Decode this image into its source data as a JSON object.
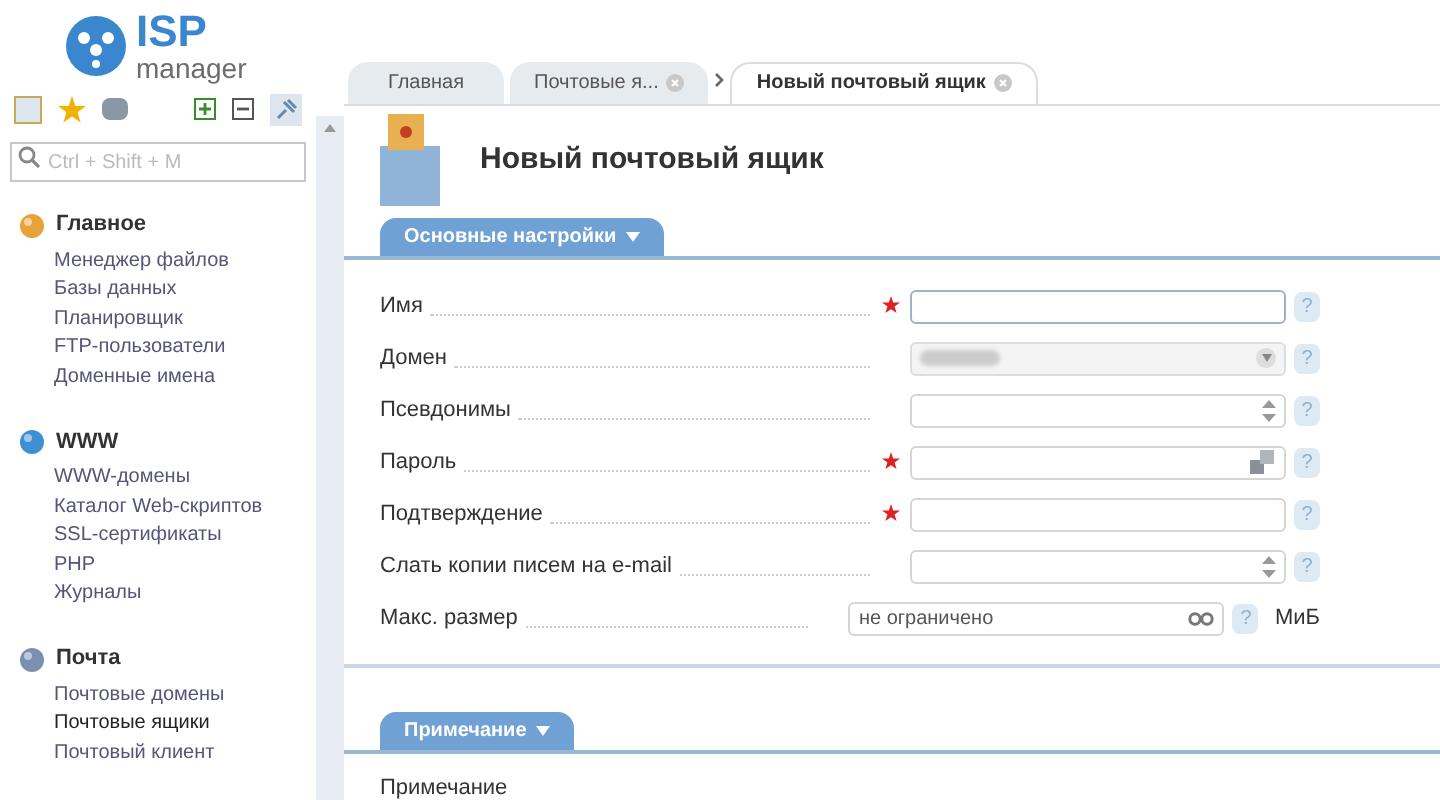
{
  "logo": {
    "brand": "ISP",
    "product": "manager"
  },
  "search": {
    "placeholder": "Ctrl + Shift + M"
  },
  "menu": [
    {
      "title": "Главное",
      "items": [
        {
          "label": "Менеджер файлов",
          "selected": false
        },
        {
          "label": "Базы данных",
          "selected": false
        },
        {
          "label": "Планировщик",
          "selected": false
        },
        {
          "label": "FTP-пользователи",
          "selected": false
        },
        {
          "label": "Доменные имена",
          "selected": false
        }
      ]
    },
    {
      "title": "WWW",
      "items": [
        {
          "label": "WWW-домены",
          "selected": false
        },
        {
          "label": "Каталог Web-скриптов",
          "selected": false
        },
        {
          "label": "SSL-сертификаты",
          "selected": false
        },
        {
          "label": "PHP",
          "selected": false
        },
        {
          "label": "Журналы",
          "selected": false
        }
      ]
    },
    {
      "title": "Почта",
      "items": [
        {
          "label": "Почтовые домены",
          "selected": false
        },
        {
          "label": "Почтовые ящики",
          "selected": true
        },
        {
          "label": "Почтовый клиент",
          "selected": false
        }
      ]
    }
  ],
  "tabs": [
    {
      "label": "Главная",
      "selected": false,
      "closable": false
    },
    {
      "label": "Почтовые я...",
      "selected": false,
      "closable": true
    },
    {
      "label": "Новый почтовый ящик",
      "selected": true,
      "closable": true
    }
  ],
  "page_title": "Новый почтовый ящик",
  "sections": [
    {
      "title": "Основные настройки",
      "fields": [
        {
          "label": "Имя",
          "required": true,
          "kind": "text",
          "help": "?"
        },
        {
          "label": "Домен",
          "required": false,
          "kind": "select",
          "help": "?"
        },
        {
          "label": "Псевдонимы",
          "required": false,
          "kind": "spinner",
          "help": "?"
        },
        {
          "label": "Пароль",
          "required": true,
          "kind": "password",
          "help": "?"
        },
        {
          "label": "Подтверждение",
          "required": true,
          "kind": "text",
          "help": "?"
        },
        {
          "label": "Слать копии писем на e-mail",
          "required": false,
          "kind": "spinner",
          "help": "?"
        },
        {
          "label": "Макс. размер",
          "required": false,
          "kind": "limit",
          "value": "не ограничено",
          "help": "?",
          "unit": "МиБ"
        }
      ]
    },
    {
      "title": "Примечание",
      "fields": [
        {
          "label": "Примечание",
          "kind": "note"
        }
      ]
    }
  ]
}
